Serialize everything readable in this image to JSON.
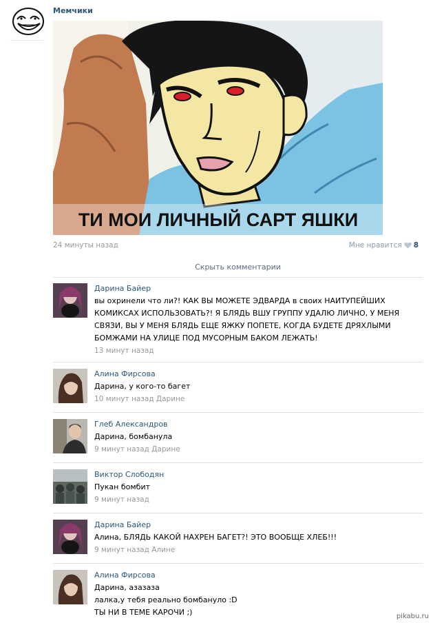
{
  "post": {
    "group_name": "Мемчики",
    "image_caption": "ТИ МОИ ЛИЧНЫЙ САРТ ЯШКИ",
    "time": "24 минуты назад",
    "like_label": "Мне нравится",
    "like_count": "8"
  },
  "hide_comments": "Скрыть комментарии",
  "comments": [
    {
      "author": "Дарина Байер",
      "text": "вы охринели что ли?! КАК ВЫ МОЖЕТЕ ЭДВАРДА в своих НАИТУПЕЙШИХ КОМИКСАХ ИСПОЛЬЗОВАТЬ?! Я БЛЯДЬ ВШУ ГРУППУ УДАЛЮ ЛИЧНО, У МЕНЯ СВЯЗИ, ВЫ У МЕНЯ БЛЯДЬ ЕЩЕ ЯЖКУ ПОПЕТЕ, КОГДА БУДЕТЕ ДРЯХЛЫМИ БОМЖАМИ НА УЛИЦЕ ПОД МУСОРНЫМ БАКОМ ЛЕЖАТЬ!",
      "meta": "13 минут назад"
    },
    {
      "author": "Алина Фирсова",
      "text": "Дарина, у кого-то багет",
      "meta": "10 минут назад Дарине"
    },
    {
      "author": "Глеб Александров",
      "text": "Дарина, бомбанула",
      "meta": "9 минут назад Дарине"
    },
    {
      "author": "Виктор Слободян",
      "text": "Пукан бомбит",
      "meta": "9 минут назад"
    },
    {
      "author": "Дарина Байер",
      "text": "Алина, БЛЯДЬ КАКОЙ НАХРЕН БАГЕТ?! ЭТО ВООБЩЕ ХЛЕБ!!!",
      "meta": "9 минут назад Алине"
    },
    {
      "author": "Алина Фирсова",
      "text": "Дарина, азазаза\nлалка,у тебя реально бомбануло :D\nТЫ НИ В ТЕМЕ КАРОЧИ ;)",
      "meta": ""
    }
  ],
  "watermark": "pikabu.ru"
}
